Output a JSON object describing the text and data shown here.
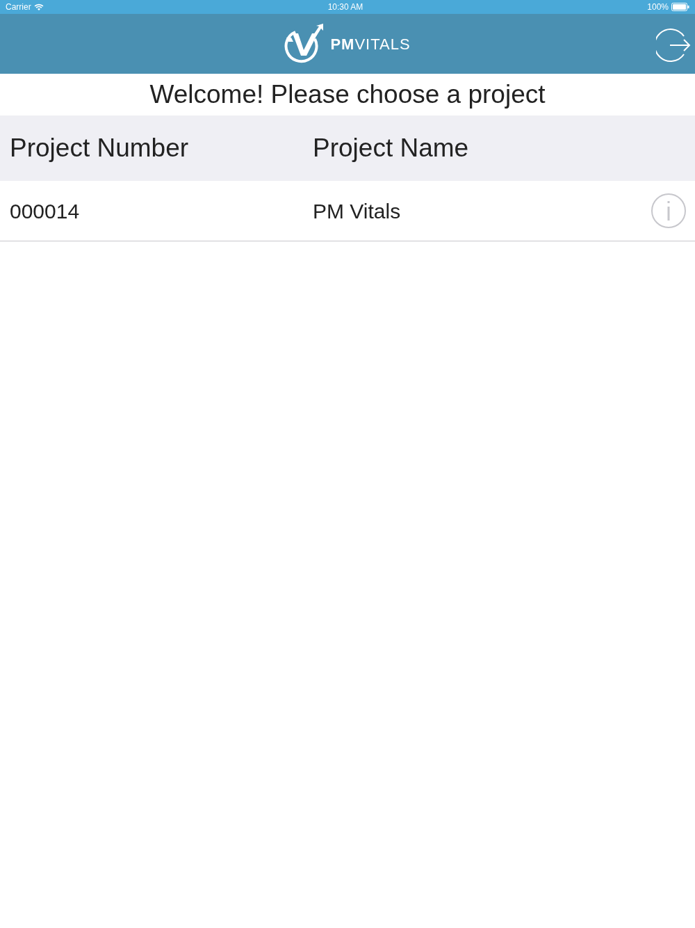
{
  "status_bar": {
    "carrier": "Carrier",
    "time": "10:30 AM",
    "battery": "100%"
  },
  "header": {
    "logo_text": "**PM**VITALS"
  },
  "title": "Welcome! Please choose a project",
  "table": {
    "columns": [
      "Project Number",
      "Project Name"
    ],
    "rows": [
      {
        "number": "000014",
        "name": "PM Vitals"
      }
    ]
  }
}
